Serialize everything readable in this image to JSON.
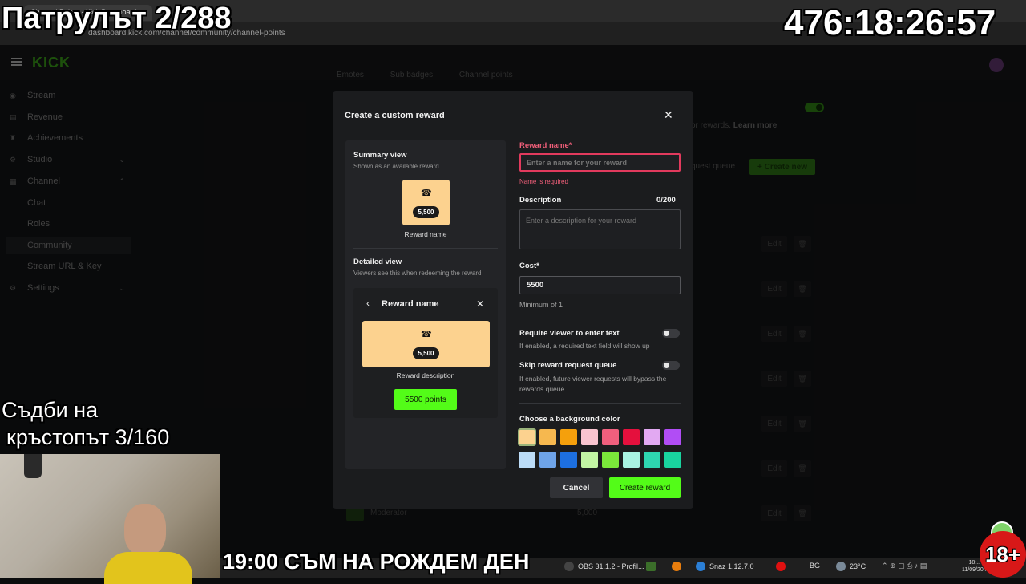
{
  "browser": {
    "tab_title": "Channel Points - Kick Dashboard",
    "url": "dashboard.kick.com/channel/community/channel-points"
  },
  "page": {
    "logo": "KICK",
    "sidebar": [
      {
        "label": "Stream",
        "icon": "broadcast-icon"
      },
      {
        "label": "Revenue",
        "icon": "revenue-icon"
      },
      {
        "label": "Achievements",
        "icon": "trophy-icon"
      },
      {
        "label": "Studio",
        "icon": "studio-icon",
        "chevron": "down"
      },
      {
        "label": "Channel",
        "icon": "channel-icon",
        "chevron": "up"
      },
      {
        "label": "Chat"
      },
      {
        "label": "Roles"
      },
      {
        "label": "Community",
        "active": true
      },
      {
        "label": "Stream URL & Key"
      },
      {
        "label": "Settings",
        "icon": "gear-icon",
        "chevron": "down"
      }
    ],
    "tabs": [
      "Emotes",
      "Sub badges",
      "Channel points"
    ],
    "rewards_hint": "or rewards.",
    "learn_more": "Learn more",
    "request_queue": "quest queue",
    "create_new": "+ Create new",
    "edit_label": "Edit",
    "moderator_row": {
      "name": "Moderator",
      "cost": "5,000"
    }
  },
  "modal": {
    "title": "Create a custom reward",
    "summary": {
      "title": "Summary view",
      "subtitle": "Shown as an available reward",
      "cost": "5,500",
      "name": "Reward name"
    },
    "detailed": {
      "title": "Detailed view",
      "subtitle": "Viewers see this when redeeming the reward",
      "name": "Reward name",
      "cost": "5,500",
      "description": "Reward description",
      "button": "5500 points"
    },
    "form": {
      "name_label": "Reward name*",
      "name_placeholder": "Enter a name for your reward",
      "name_error": "Name is required",
      "description_label": "Description",
      "description_count": "0/200",
      "description_placeholder": "Enter a description for your reward",
      "cost_label": "Cost*",
      "cost_value": "5500",
      "cost_hint": "Minimum of 1",
      "require_text_label": "Require viewer to enter text",
      "require_text_hint": "If enabled, a required text field will show up",
      "skip_queue_label": "Skip reward request queue",
      "skip_queue_hint": "If enabled, future viewer requests will bypass the rewards queue",
      "color_label": "Choose a background color",
      "colors": [
        "#fcd28f",
        "#f6b84f",
        "#f5a00c",
        "#f9c4cf",
        "#f05f7d",
        "#e5103d",
        "#e2a9f2",
        "#b14df5",
        "#bcdcf7",
        "#6ea3e8",
        "#1d6fe0",
        "#c3f5a4",
        "#7be83a",
        "#a9f3e2",
        "#2ed6b0",
        "#19d49f"
      ],
      "selected_color": "#fcd28f"
    },
    "cancel": "Cancel",
    "create": "Create reward"
  },
  "overlays": {
    "patrol_counter": "Патрулът 2/288",
    "timer": "476:18:26:57",
    "fates_line1": "Съдби на",
    "fates_line2": "кръстопът 3/160",
    "birthday": "19:00 СЪМ НА РОЖДЕМ ДЕН",
    "age_badge": "18+"
  },
  "taskbar": {
    "obs": "OBS 31.1.2 - Profil...",
    "snaz": "Snaz 1.12.7.0",
    "language": "BG",
    "temperature": "23°C",
    "clock_time": "18:..",
    "clock_date": "11/09/20.."
  }
}
